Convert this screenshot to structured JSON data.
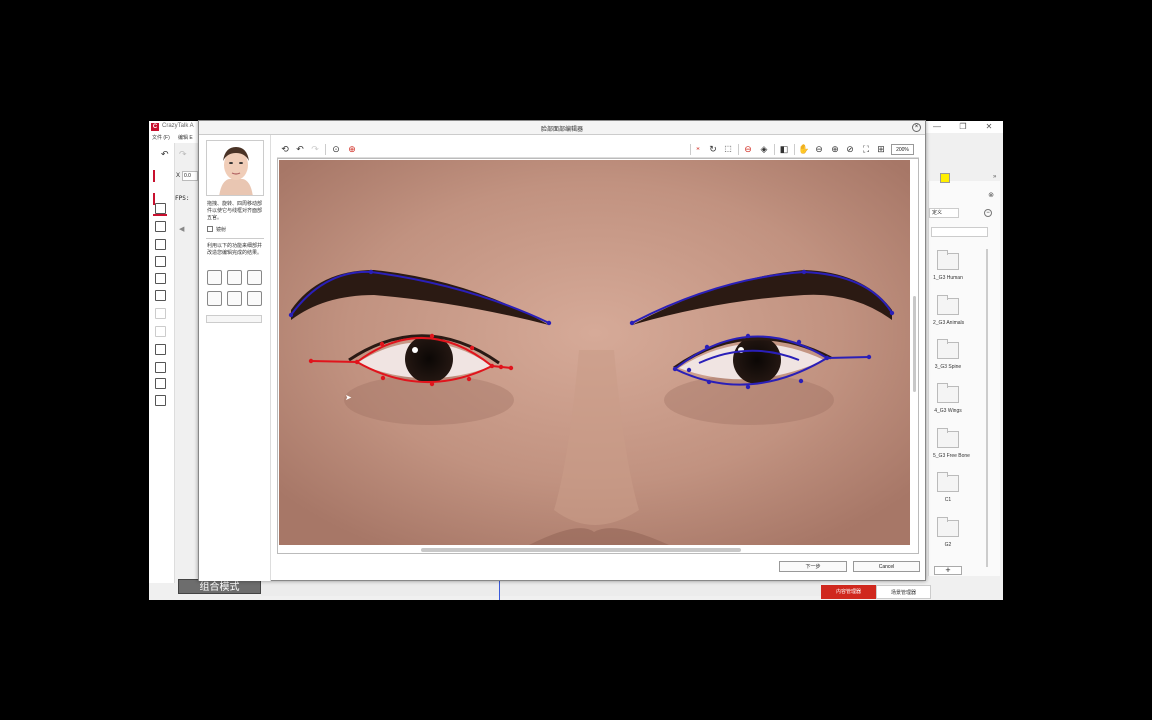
{
  "app": {
    "title": "CrazyTalk A",
    "logo": "C",
    "menu": [
      "文件 (F)",
      "编辑 E"
    ],
    "x_label": "X",
    "x_value": "0.0",
    "fps_label": "FPS:",
    "mode_label": "组合模式",
    "window_controls": [
      "—",
      "❐",
      "✕"
    ]
  },
  "right_panel": {
    "tab_label": "定义",
    "folders": [
      "1_G3 Human",
      "2_G3 Animals",
      "3_G3 Spine",
      "4_G3 Wings",
      "5_G3 Free Bone",
      "C1",
      "G2"
    ],
    "add_label": "+",
    "swatch_color": "#ffef00",
    "arrow": "»"
  },
  "bottom_tabs": {
    "content_manager": "内容管理器",
    "scene_manager": "场景管理器"
  },
  "dialog": {
    "title": "脸部面部编辑器",
    "close": "×",
    "instruction_1": "拖拽、旋转、四周移动部件以使它与线框对齐面部五官。",
    "mirror_label": "镜射",
    "instruction_2": "利用以下的功能来细部并改造您编辑完成的结果。",
    "zoom_value": "200%",
    "next_label": "下一步",
    "cancel_label": "Cancel",
    "accent_color": "#d0281e",
    "outline_right_color": "#e0141c",
    "outline_left_color": "#2a1fb8"
  }
}
